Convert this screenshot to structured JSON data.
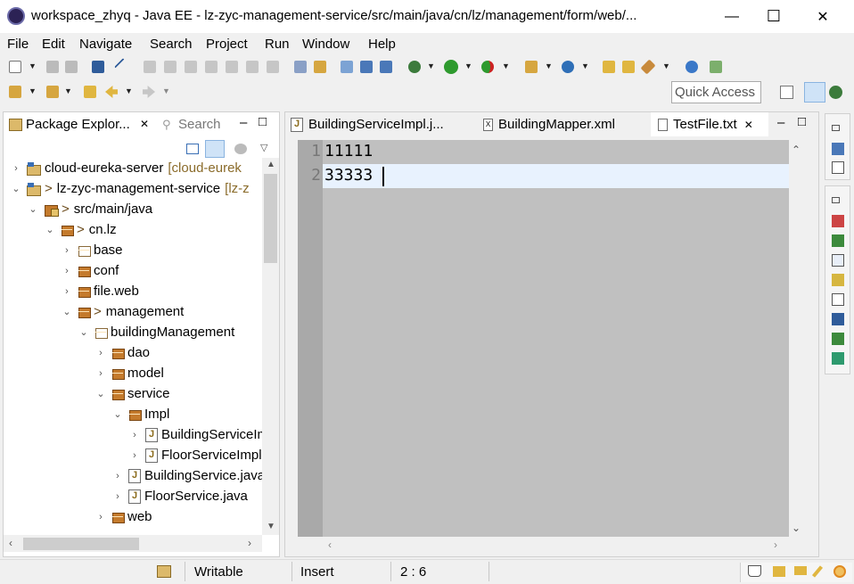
{
  "window": {
    "title": "workspace_zhyq - Java EE - lz-zyc-management-service/src/main/java/cn/lz/management/form/web/...",
    "minimize": "—",
    "maximize": "☐",
    "close": "✕"
  },
  "menu": [
    "File",
    "Edit",
    "Navigate",
    "Search",
    "Project",
    "Run",
    "Window",
    "Help"
  ],
  "toolbar": {
    "quick_access": "Quick Access"
  },
  "explorer": {
    "tab_active": "Package Explor...",
    "tab_close": "✕",
    "tab_inactive": "Search",
    "minimize": "–",
    "maximize": "□",
    "tree": [
      {
        "label": "cloud-eureka-server",
        "suffix": "[cloud-eurek",
        "arrow": "›",
        "icon": "project-icon",
        "decor": ""
      },
      {
        "label": "lz-zyc-management-service",
        "suffix": "[lz-z",
        "arrow": "⌄",
        "icon": "project-icon",
        "decor": ">"
      },
      {
        "label": "src/main/java",
        "suffix": "",
        "arrow": "⌄",
        "icon": "source-folder-icon",
        "decor": ">"
      },
      {
        "label": "cn.lz",
        "suffix": "",
        "arrow": "⌄",
        "icon": "package-icon",
        "decor": ">"
      },
      {
        "label": "base",
        "suffix": "",
        "arrow": "›",
        "icon": "package-icon",
        "decor": ""
      },
      {
        "label": "conf",
        "suffix": "",
        "arrow": "›",
        "icon": "package-icon",
        "decor": ""
      },
      {
        "label": "file.web",
        "suffix": "",
        "arrow": "›",
        "icon": "package-icon",
        "decor": ""
      },
      {
        "label": "management",
        "suffix": "",
        "arrow": "⌄",
        "icon": "package-icon",
        "decor": ">"
      },
      {
        "label": "buildingManagement",
        "suffix": "",
        "arrow": "⌄",
        "icon": "package-icon",
        "decor": ""
      },
      {
        "label": "dao",
        "suffix": "",
        "arrow": "›",
        "icon": "package-icon",
        "decor": ""
      },
      {
        "label": "model",
        "suffix": "",
        "arrow": "›",
        "icon": "package-icon",
        "decor": ""
      },
      {
        "label": "service",
        "suffix": "",
        "arrow": "⌄",
        "icon": "package-icon",
        "decor": ""
      },
      {
        "label": "Impl",
        "suffix": "",
        "arrow": "⌄",
        "icon": "package-icon",
        "decor": ""
      },
      {
        "label": "BuildingServiceImpl.java",
        "suffix": "",
        "arrow": "›",
        "icon": "java-file-icon",
        "decor": ""
      },
      {
        "label": "FloorServiceImpl.java",
        "suffix": "",
        "arrow": "›",
        "icon": "java-file-icon",
        "decor": ""
      },
      {
        "label": "BuildingService.java",
        "suffix": "",
        "arrow": "›",
        "icon": "java-file-icon",
        "decor": ""
      },
      {
        "label": "FloorService.java",
        "suffix": "",
        "arrow": "›",
        "icon": "java-file-icon",
        "decor": ""
      },
      {
        "label": "web",
        "suffix": "",
        "arrow": "›",
        "icon": "package-icon",
        "decor": ""
      }
    ]
  },
  "editor": {
    "tabs": [
      {
        "label": "BuildingServiceImpl.j...",
        "icon": "java-file-icon"
      },
      {
        "label": "BuildingMapper.xml",
        "icon": "xml-file-icon"
      },
      {
        "label": "TestFile.txt",
        "icon": "text-file-icon",
        "close": "✕"
      }
    ],
    "minimize": "–",
    "maximize": "□",
    "lines": [
      {
        "num": "1",
        "text": "11111"
      },
      {
        "num": "2",
        "text": "33333"
      }
    ]
  },
  "status": {
    "writable": "Writable",
    "insert_mode": "Insert",
    "position": "2 : 6"
  },
  "colors": {
    "current_line": "#e8f2fe",
    "editor_bg": "#c0c0c0",
    "ruler_bg": "#a9a9a9",
    "project_suffix": "#8a6b2a"
  }
}
